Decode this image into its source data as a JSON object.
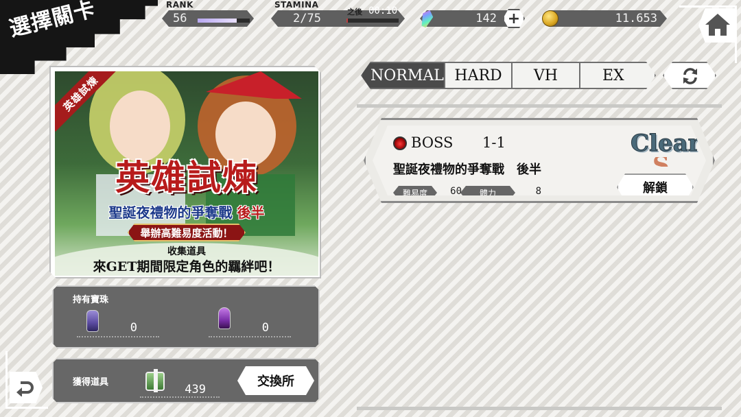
{
  "header": {
    "title": "選擇關卡",
    "rank_label": "RANK",
    "rank_value": "56",
    "rank_progress": 0.75,
    "stamina_label": "STAMINA",
    "stamina_value": "2/75",
    "stamina_after_label": "之後",
    "stamina_timer": "00:10",
    "stamina_progress": 0.03,
    "gems": "142",
    "gold": "11.653"
  },
  "event": {
    "tag": "英雄試煉",
    "title": "英雄試煉",
    "subtitle_part1": "聖誕夜禮物的爭奪戰",
    "subtitle_part2": "後半",
    "hard_note": "舉辦高難易度活動！",
    "collect_line": "收集道具",
    "limited_line": "來GET期間限定角色的羈絆吧！"
  },
  "orbs": {
    "label": "持有寶珠",
    "orb1_count": "0",
    "orb2_count": "0"
  },
  "items": {
    "label": "獲得道具",
    "count": "439",
    "exchange_label": "交換所"
  },
  "tabs": [
    "NORMAL",
    "HARD",
    "VH",
    "EX"
  ],
  "active_tab": "NORMAL",
  "quest": {
    "type": "BOSS",
    "number": "1-1",
    "name": "聖誕夜禮物的爭奪戰　後半",
    "difficulty_label": "難易度",
    "difficulty_value": "60",
    "stamina_label": "體力",
    "stamina_value": "8",
    "clear_stamp": "Clear",
    "rank_stamp": "S",
    "unlock_label": "解鎖"
  },
  "colors": {
    "event_red": "#b81b1b",
    "event_blue": "#1d3a8a",
    "panel_gray": "#676767",
    "clear_stamp": "#4a6a7a"
  },
  "icons": [
    "home-icon",
    "back-icon",
    "refresh-icon",
    "gem-icon",
    "coin-icon",
    "plus-icon",
    "boss-icon",
    "orb-icon",
    "gift-icon"
  ]
}
